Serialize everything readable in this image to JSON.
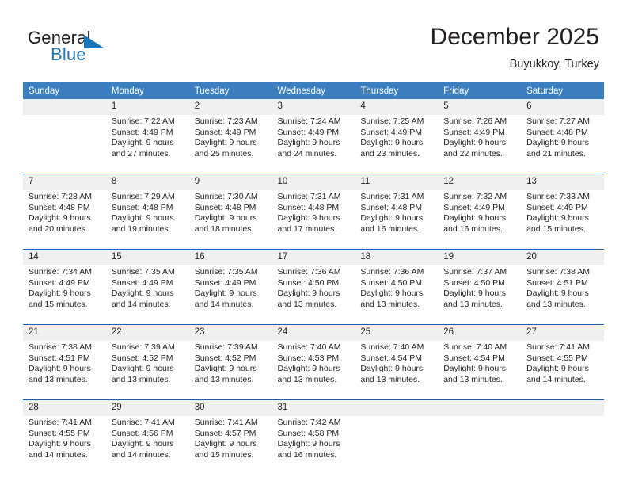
{
  "logo": {
    "word_primary": "General",
    "word_secondary": "Blue",
    "triangle_icon": "triangle-icon",
    "primary_color": "#231f20",
    "accent_color": "#1b75bb"
  },
  "header": {
    "title": "December 2025",
    "subtitle": "Buyukkoy, Turkey"
  },
  "theme": {
    "header_row_bg": "#3c7fc1",
    "daynum_bg": "#f0f0f0",
    "rule_color": "#1b5fa8",
    "text_color": "#231f20"
  },
  "calendar": {
    "weekdays": [
      "Sunday",
      "Monday",
      "Tuesday",
      "Wednesday",
      "Thursday",
      "Friday",
      "Saturday"
    ],
    "weeks": [
      [
        {
          "day": "",
          "sunrise": "",
          "sunset": "",
          "daylight": ""
        },
        {
          "day": "1",
          "sunrise": "Sunrise: 7:22 AM",
          "sunset": "Sunset: 4:49 PM",
          "daylight": "Daylight: 9 hours and 27 minutes."
        },
        {
          "day": "2",
          "sunrise": "Sunrise: 7:23 AM",
          "sunset": "Sunset: 4:49 PM",
          "daylight": "Daylight: 9 hours and 25 minutes."
        },
        {
          "day": "3",
          "sunrise": "Sunrise: 7:24 AM",
          "sunset": "Sunset: 4:49 PM",
          "daylight": "Daylight: 9 hours and 24 minutes."
        },
        {
          "day": "4",
          "sunrise": "Sunrise: 7:25 AM",
          "sunset": "Sunset: 4:49 PM",
          "daylight": "Daylight: 9 hours and 23 minutes."
        },
        {
          "day": "5",
          "sunrise": "Sunrise: 7:26 AM",
          "sunset": "Sunset: 4:49 PM",
          "daylight": "Daylight: 9 hours and 22 minutes."
        },
        {
          "day": "6",
          "sunrise": "Sunrise: 7:27 AM",
          "sunset": "Sunset: 4:48 PM",
          "daylight": "Daylight: 9 hours and 21 minutes."
        }
      ],
      [
        {
          "day": "7",
          "sunrise": "Sunrise: 7:28 AM",
          "sunset": "Sunset: 4:48 PM",
          "daylight": "Daylight: 9 hours and 20 minutes."
        },
        {
          "day": "8",
          "sunrise": "Sunrise: 7:29 AM",
          "sunset": "Sunset: 4:48 PM",
          "daylight": "Daylight: 9 hours and 19 minutes."
        },
        {
          "day": "9",
          "sunrise": "Sunrise: 7:30 AM",
          "sunset": "Sunset: 4:48 PM",
          "daylight": "Daylight: 9 hours and 18 minutes."
        },
        {
          "day": "10",
          "sunrise": "Sunrise: 7:31 AM",
          "sunset": "Sunset: 4:48 PM",
          "daylight": "Daylight: 9 hours and 17 minutes."
        },
        {
          "day": "11",
          "sunrise": "Sunrise: 7:31 AM",
          "sunset": "Sunset: 4:48 PM",
          "daylight": "Daylight: 9 hours and 16 minutes."
        },
        {
          "day": "12",
          "sunrise": "Sunrise: 7:32 AM",
          "sunset": "Sunset: 4:49 PM",
          "daylight": "Daylight: 9 hours and 16 minutes."
        },
        {
          "day": "13",
          "sunrise": "Sunrise: 7:33 AM",
          "sunset": "Sunset: 4:49 PM",
          "daylight": "Daylight: 9 hours and 15 minutes."
        }
      ],
      [
        {
          "day": "14",
          "sunrise": "Sunrise: 7:34 AM",
          "sunset": "Sunset: 4:49 PM",
          "daylight": "Daylight: 9 hours and 15 minutes."
        },
        {
          "day": "15",
          "sunrise": "Sunrise: 7:35 AM",
          "sunset": "Sunset: 4:49 PM",
          "daylight": "Daylight: 9 hours and 14 minutes."
        },
        {
          "day": "16",
          "sunrise": "Sunrise: 7:35 AM",
          "sunset": "Sunset: 4:49 PM",
          "daylight": "Daylight: 9 hours and 14 minutes."
        },
        {
          "day": "17",
          "sunrise": "Sunrise: 7:36 AM",
          "sunset": "Sunset: 4:50 PM",
          "daylight": "Daylight: 9 hours and 13 minutes."
        },
        {
          "day": "18",
          "sunrise": "Sunrise: 7:36 AM",
          "sunset": "Sunset: 4:50 PM",
          "daylight": "Daylight: 9 hours and 13 minutes."
        },
        {
          "day": "19",
          "sunrise": "Sunrise: 7:37 AM",
          "sunset": "Sunset: 4:50 PM",
          "daylight": "Daylight: 9 hours and 13 minutes."
        },
        {
          "day": "20",
          "sunrise": "Sunrise: 7:38 AM",
          "sunset": "Sunset: 4:51 PM",
          "daylight": "Daylight: 9 hours and 13 minutes."
        }
      ],
      [
        {
          "day": "21",
          "sunrise": "Sunrise: 7:38 AM",
          "sunset": "Sunset: 4:51 PM",
          "daylight": "Daylight: 9 hours and 13 minutes."
        },
        {
          "day": "22",
          "sunrise": "Sunrise: 7:39 AM",
          "sunset": "Sunset: 4:52 PM",
          "daylight": "Daylight: 9 hours and 13 minutes."
        },
        {
          "day": "23",
          "sunrise": "Sunrise: 7:39 AM",
          "sunset": "Sunset: 4:52 PM",
          "daylight": "Daylight: 9 hours and 13 minutes."
        },
        {
          "day": "24",
          "sunrise": "Sunrise: 7:40 AM",
          "sunset": "Sunset: 4:53 PM",
          "daylight": "Daylight: 9 hours and 13 minutes."
        },
        {
          "day": "25",
          "sunrise": "Sunrise: 7:40 AM",
          "sunset": "Sunset: 4:54 PM",
          "daylight": "Daylight: 9 hours and 13 minutes."
        },
        {
          "day": "26",
          "sunrise": "Sunrise: 7:40 AM",
          "sunset": "Sunset: 4:54 PM",
          "daylight": "Daylight: 9 hours and 13 minutes."
        },
        {
          "day": "27",
          "sunrise": "Sunrise: 7:41 AM",
          "sunset": "Sunset: 4:55 PM",
          "daylight": "Daylight: 9 hours and 14 minutes."
        }
      ],
      [
        {
          "day": "28",
          "sunrise": "Sunrise: 7:41 AM",
          "sunset": "Sunset: 4:55 PM",
          "daylight": "Daylight: 9 hours and 14 minutes."
        },
        {
          "day": "29",
          "sunrise": "Sunrise: 7:41 AM",
          "sunset": "Sunset: 4:56 PM",
          "daylight": "Daylight: 9 hours and 14 minutes."
        },
        {
          "day": "30",
          "sunrise": "Sunrise: 7:41 AM",
          "sunset": "Sunset: 4:57 PM",
          "daylight": "Daylight: 9 hours and 15 minutes."
        },
        {
          "day": "31",
          "sunrise": "Sunrise: 7:42 AM",
          "sunset": "Sunset: 4:58 PM",
          "daylight": "Daylight: 9 hours and 16 minutes."
        },
        {
          "day": "",
          "sunrise": "",
          "sunset": "",
          "daylight": ""
        },
        {
          "day": "",
          "sunrise": "",
          "sunset": "",
          "daylight": ""
        },
        {
          "day": "",
          "sunrise": "",
          "sunset": "",
          "daylight": ""
        }
      ]
    ]
  }
}
